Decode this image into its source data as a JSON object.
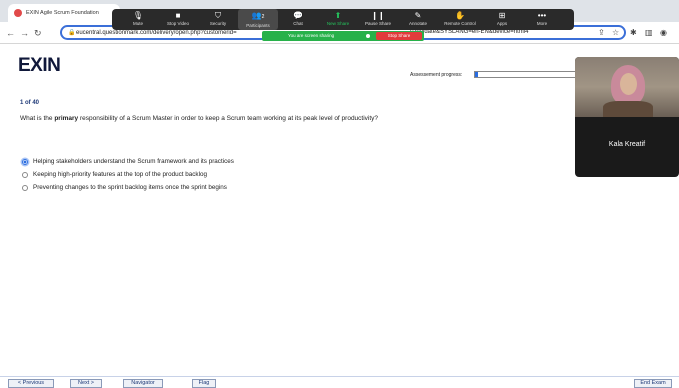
{
  "browser": {
    "tab_title": "EXIN Agile Scrum Foundation",
    "url_left": "eucentral.questionmark.com/delivery/open.php?customerid=",
    "url_right": "candidate&SYSLANG=en-EN&device=html4"
  },
  "zoom": {
    "items": [
      {
        "label": "Mute",
        "icon": "microphone-icon"
      },
      {
        "label": "Stop Video",
        "icon": "video-camera-icon"
      },
      {
        "label": "Security",
        "icon": "shield-icon"
      },
      {
        "label": "Participants",
        "icon": "people-icon",
        "count": "2"
      },
      {
        "label": "Chat",
        "icon": "chat-bubble-icon"
      },
      {
        "label": "New Share",
        "icon": "share-screen-icon"
      },
      {
        "label": "Pause Share",
        "icon": "pause-icon"
      },
      {
        "label": "Annotate",
        "icon": "pen-icon"
      },
      {
        "label": "Remote Control",
        "icon": "remote-control-icon"
      },
      {
        "label": "Apps",
        "icon": "apps-icon"
      },
      {
        "label": "More",
        "icon": "more-icon"
      }
    ],
    "sharing_text": "You are screen sharing",
    "stop_share_label": "Stop Share"
  },
  "exam": {
    "logo_text": "EXIN",
    "progress_label": "Assessement progress:",
    "progress_fraction": 0.025,
    "question_number": "1  of 40",
    "question_prefix": "What is the ",
    "question_emphasis": "primary",
    "question_suffix": " responsibility of a Scrum Master in order to keep a Scrum team working at its peak level of productivity?",
    "options": [
      {
        "label": "Helping stakeholders understand the Scrum framework and its practices",
        "selected": true
      },
      {
        "label": "Keeping high-priority features at the top of the product backlog",
        "selected": false
      },
      {
        "label": "Preventing changes to the sprint backlog items once the sprint begins",
        "selected": false
      }
    ]
  },
  "video": {
    "participant_name": "Kala Kreatif"
  },
  "footer": {
    "previous": "< Previous",
    "next": "Next >",
    "navigator": "Navigator",
    "flag": "Flag",
    "end_exam": "End Exam"
  },
  "colors": {
    "accent": "#2a6de0",
    "share_green": "#27b14a",
    "stop_red": "#e23b3b",
    "logo": "#10183a"
  }
}
